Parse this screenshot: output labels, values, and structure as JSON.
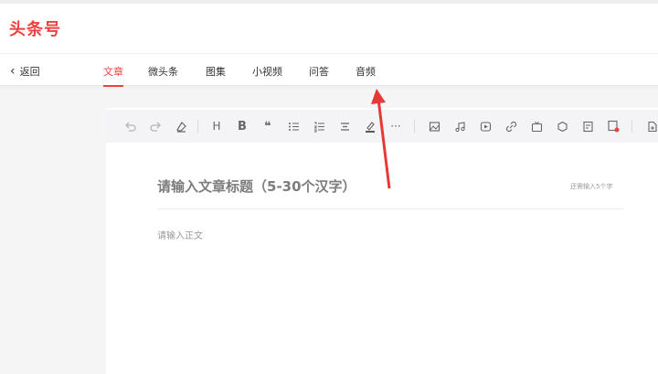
{
  "header": {
    "logo": "头条号"
  },
  "nav": {
    "back_label": "返回",
    "tabs": [
      {
        "label": "文章",
        "active": true
      },
      {
        "label": "微头条",
        "active": false
      },
      {
        "label": "图集",
        "active": false
      },
      {
        "label": "小视频",
        "active": false
      },
      {
        "label": "问答",
        "active": false
      },
      {
        "label": "音频",
        "active": false
      }
    ]
  },
  "toolbar": {
    "icons": [
      "undo-icon",
      "redo-icon",
      "eraser-icon",
      "heading-icon",
      "bold-icon",
      "quote-icon",
      "bullet-list-icon",
      "numbered-list-icon",
      "align-icon",
      "highlighter-icon",
      "more-icon",
      "image-icon",
      "music-icon",
      "video-icon",
      "link-icon",
      "tv-icon",
      "gear-icon",
      "template-icon",
      "ad-icon",
      "import-icon"
    ],
    "heading_label": "H",
    "bold_label": "B",
    "quote_label": "❝",
    "more_label": "···"
  },
  "editor": {
    "title_placeholder": "请输入文章标题（5-30个汉字）",
    "title_hint": "还需输入5个字",
    "body_placeholder": "请输入正文"
  },
  "colors": {
    "accent": "#f04142",
    "annotation_arrow": "#e53935"
  }
}
